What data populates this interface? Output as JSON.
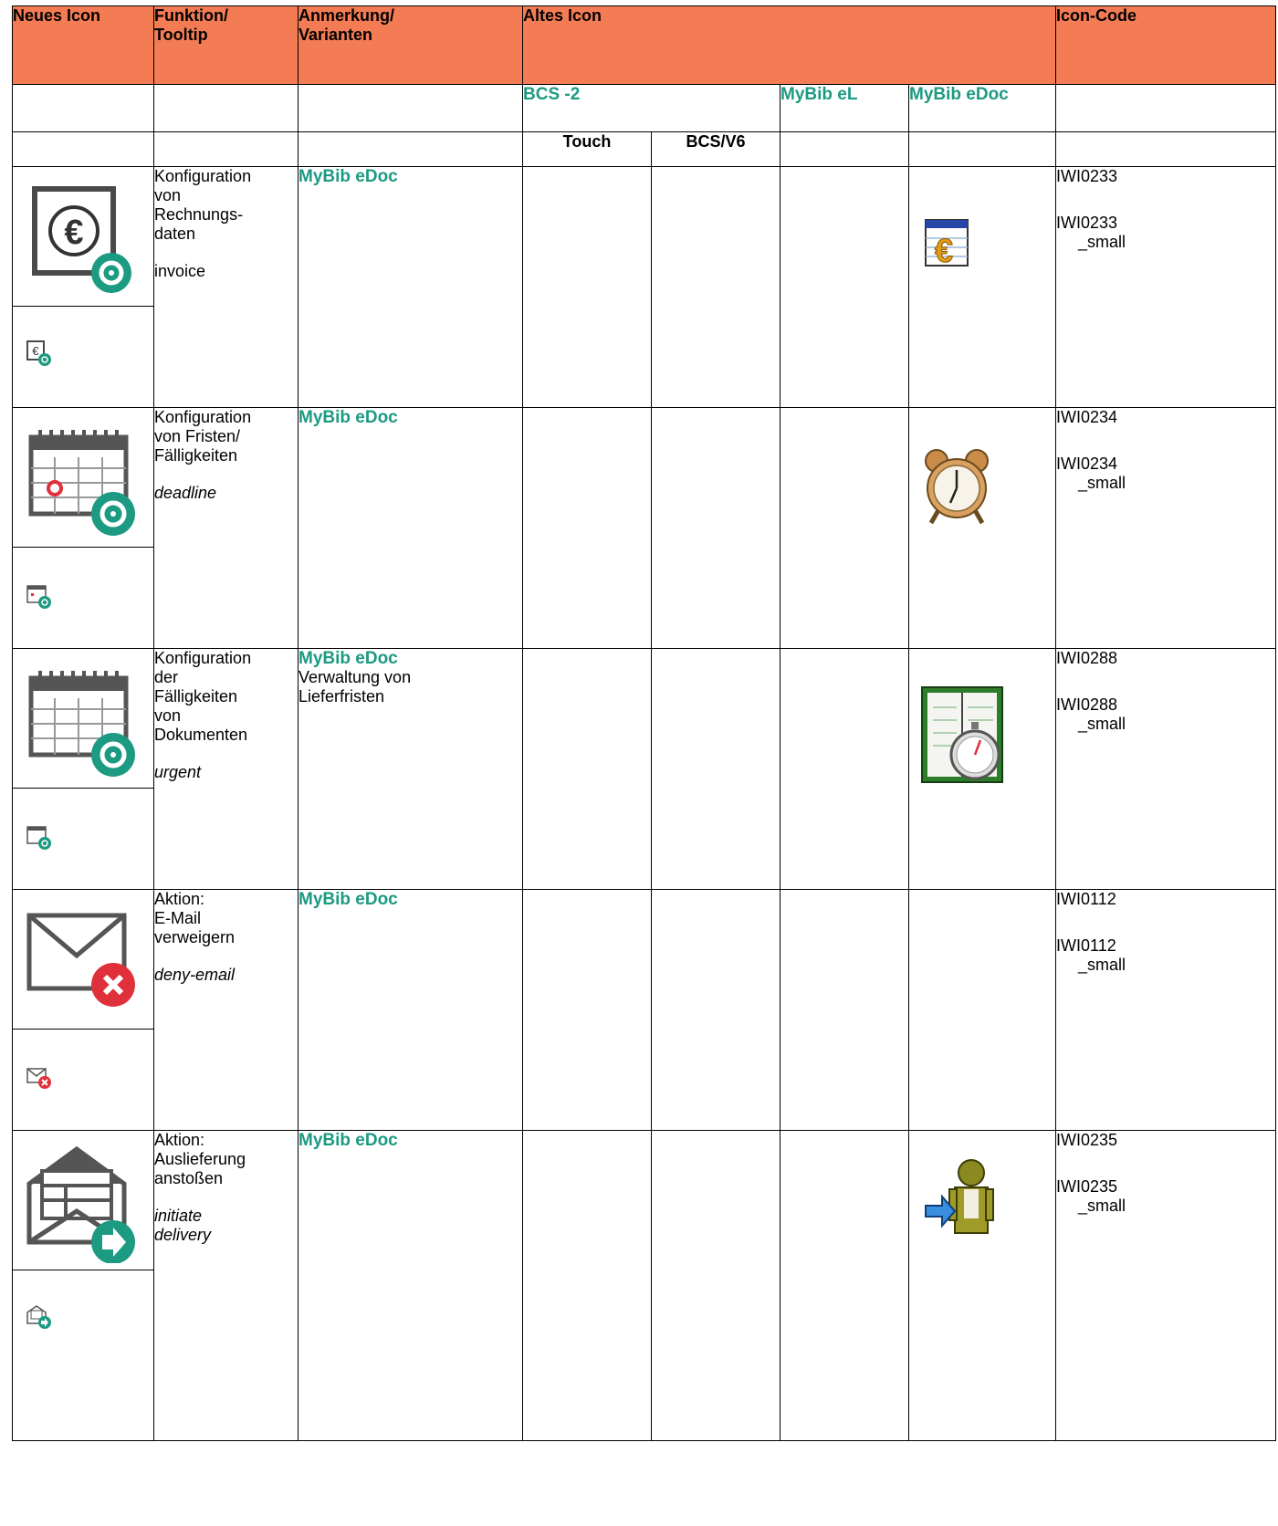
{
  "header": {
    "col1": "Neues Icon",
    "col2": "Funktion/\nTooltip",
    "col3": "Anmerkung/\nVarianten",
    "col4": "Altes Icon",
    "col5": "Icon-Code"
  },
  "subheader": {
    "bcs2": "BCS -2",
    "mybib_el": "MyBib eL",
    "mybib_edoc": "MyBib eDoc",
    "touch": "Touch",
    "bcs_v6": "BCS/V6"
  },
  "rows": [
    {
      "function": "Konfiguration\nvon\nRechnungs-\ndaten",
      "tooltip": "invoice",
      "note_tag": "MyBib eDoc",
      "note_text": "",
      "code": "IWI0233",
      "code_small_1": "IWI0233",
      "code_small_2": "_small",
      "new_icon": "invoice-settings-icon",
      "old_icon": "euro-table-icon"
    },
    {
      "function": "Konfiguration\nvon Fristen/\nFälligkeiten",
      "tooltip": "deadline",
      "note_tag": "MyBib eDoc",
      "note_text": "",
      "code": "IWI0234",
      "code_small_1": "IWI0234",
      "code_small_2": "_small",
      "new_icon": "calendar-deadline-settings-icon",
      "old_icon": "alarm-clock-icon"
    },
    {
      "function": "Konfiguration\nder\nFälligkeiten\nvon\nDokumenten",
      "tooltip": "urgent",
      "note_tag": "MyBib eDoc",
      "note_text": "Verwaltung von\nLieferfristen",
      "code": "IWI0288",
      "code_small_1": "IWI0288",
      "code_small_2": "_small",
      "new_icon": "calendar-settings-icon",
      "old_icon": "planner-stopwatch-icon"
    },
    {
      "function": "Aktion:\nE-Mail\nverweigern",
      "tooltip": "deny-email",
      "note_tag": "MyBib eDoc",
      "note_text": "",
      "code": "IWI0112",
      "code_small_1": "IWI0112",
      "code_small_2": "_small",
      "new_icon": "deny-email-icon",
      "old_icon": ""
    },
    {
      "function": "Aktion:\nAuslieferung\nanstoßen",
      "tooltip": "initiate\ndelivery",
      "note_tag": "MyBib eDoc",
      "note_text": "",
      "code": "IWI0235",
      "code_small_1": "IWI0235",
      "code_small_2": "_small",
      "new_icon": "initiate-delivery-icon",
      "old_icon": "person-arrow-icon"
    }
  ],
  "colors": {
    "header_bg": "#f47c55",
    "accent_teal": "#1c9a82",
    "icon_gray": "#4a4a4a",
    "icon_red": "#e0303b"
  }
}
